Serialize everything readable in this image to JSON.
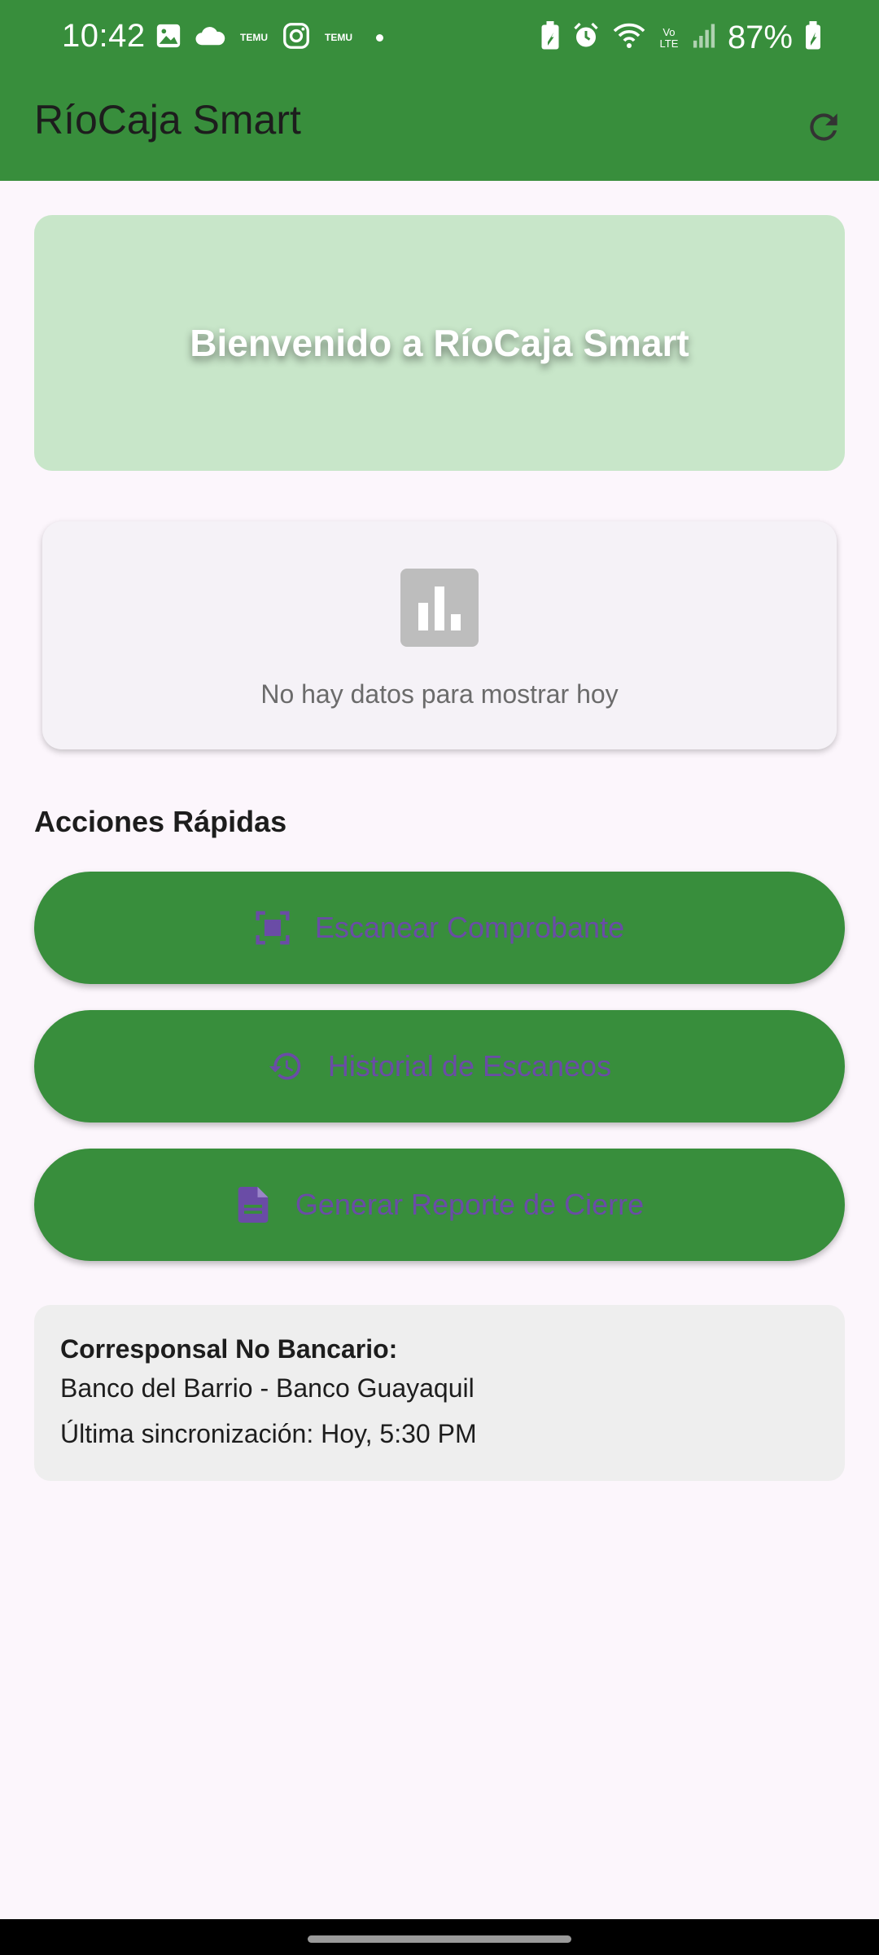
{
  "status_bar": {
    "time": "10:42",
    "temu_label": "TEMU",
    "battery": "87%",
    "left_icons": [
      "image-icon",
      "cloud-icon",
      "temu-icon",
      "instagram-icon",
      "temu-icon",
      "dot-icon"
    ],
    "right_icons": [
      "battery-saver-icon",
      "alarm-icon",
      "wifi-icon",
      "volte-icon",
      "signal-icon",
      "battery-charging-icon"
    ],
    "volte_label": "Vo LTE"
  },
  "app_bar": {
    "title": "RíoCaja Smart",
    "refresh_icon": "refresh-icon"
  },
  "welcome": {
    "text": "Bienvenido a RíoCaja Smart"
  },
  "chart_placeholder": {
    "icon": "bar-chart-icon",
    "message": "No hay datos para mostrar hoy"
  },
  "quick_actions": {
    "title": "Acciones Rápidas",
    "buttons": [
      {
        "label": "Escanear Comprobante",
        "icon": "scan-document-icon"
      },
      {
        "label": "Historial de Escaneos",
        "icon": "history-icon"
      },
      {
        "label": "Generar Reporte de Cierre",
        "icon": "file-icon"
      }
    ]
  },
  "info": {
    "title": "Corresponsal No Bancario:",
    "bank": "Banco del Barrio - Banco Guayaquil",
    "sync": "Última sincronización: Hoy, 5:30 PM"
  },
  "colors": {
    "primary": "#388e3c",
    "welcome_bg": "#c8e6c9",
    "button_text": "#6a4ca6",
    "background": "#fcf6fc"
  }
}
